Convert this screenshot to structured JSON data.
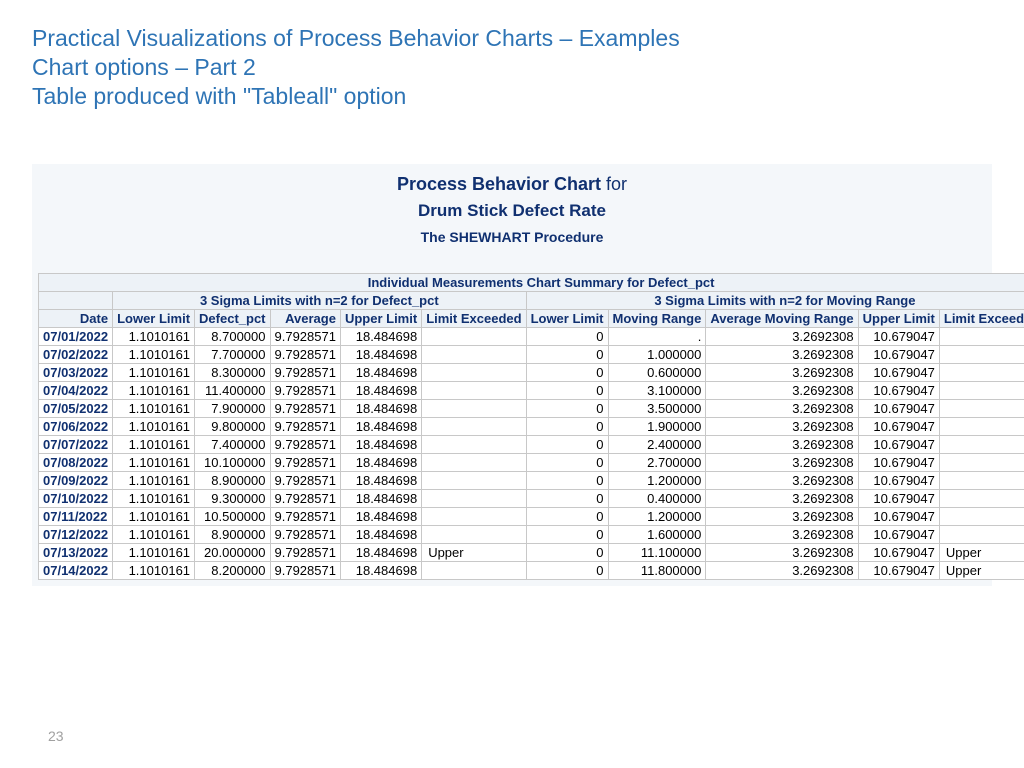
{
  "heading": {
    "line1": "Practical Visualizations of Process Behavior Charts – Examples",
    "line2": "Chart options – Part 2",
    "line3": "Table produced with \"Tableall\" option"
  },
  "report": {
    "title_prefix": "Process Behavior Chart",
    "title_for": "for",
    "title_subject": "Drum Stick Defect Rate",
    "procedure": "The SHEWHART Procedure",
    "summary_heading": "Individual Measurements Chart Summary for Defect_pct",
    "group1": "3 Sigma Limits with n=2 for Defect_pct",
    "group2": "3 Sigma Limits with n=2 for Moving Range",
    "cols": {
      "date": "Date",
      "lower_limit": "Lower Limit",
      "defect_pct": "Defect_pct",
      "average": "Average",
      "upper_limit": "Upper Limit",
      "limit_exceeded": "Limit Exceeded",
      "mr_lower_limit": "Lower Limit",
      "moving_range": "Moving Range",
      "avg_moving_range": "Average Moving Range",
      "mr_upper_limit": "Upper Limit",
      "mr_limit_exceeded": "Limit Exceeded"
    }
  },
  "chart_data": {
    "type": "table",
    "title": "Individual Measurements Chart Summary for Defect_pct",
    "rows": [
      {
        "date": "07/01/2022",
        "ll": "1.1010161",
        "defect": "8.700000",
        "avg": "9.7928571",
        "ul": "18.484698",
        "le": "",
        "mrll": "0",
        "mr": ".",
        "amr": "3.2692308",
        "mrul": "10.679047",
        "mrle": ""
      },
      {
        "date": "07/02/2022",
        "ll": "1.1010161",
        "defect": "7.700000",
        "avg": "9.7928571",
        "ul": "18.484698",
        "le": "",
        "mrll": "0",
        "mr": "1.000000",
        "amr": "3.2692308",
        "mrul": "10.679047",
        "mrle": ""
      },
      {
        "date": "07/03/2022",
        "ll": "1.1010161",
        "defect": "8.300000",
        "avg": "9.7928571",
        "ul": "18.484698",
        "le": "",
        "mrll": "0",
        "mr": "0.600000",
        "amr": "3.2692308",
        "mrul": "10.679047",
        "mrle": ""
      },
      {
        "date": "07/04/2022",
        "ll": "1.1010161",
        "defect": "11.400000",
        "avg": "9.7928571",
        "ul": "18.484698",
        "le": "",
        "mrll": "0",
        "mr": "3.100000",
        "amr": "3.2692308",
        "mrul": "10.679047",
        "mrle": ""
      },
      {
        "date": "07/05/2022",
        "ll": "1.1010161",
        "defect": "7.900000",
        "avg": "9.7928571",
        "ul": "18.484698",
        "le": "",
        "mrll": "0",
        "mr": "3.500000",
        "amr": "3.2692308",
        "mrul": "10.679047",
        "mrle": ""
      },
      {
        "date": "07/06/2022",
        "ll": "1.1010161",
        "defect": "9.800000",
        "avg": "9.7928571",
        "ul": "18.484698",
        "le": "",
        "mrll": "0",
        "mr": "1.900000",
        "amr": "3.2692308",
        "mrul": "10.679047",
        "mrle": ""
      },
      {
        "date": "07/07/2022",
        "ll": "1.1010161",
        "defect": "7.400000",
        "avg": "9.7928571",
        "ul": "18.484698",
        "le": "",
        "mrll": "0",
        "mr": "2.400000",
        "amr": "3.2692308",
        "mrul": "10.679047",
        "mrle": ""
      },
      {
        "date": "07/08/2022",
        "ll": "1.1010161",
        "defect": "10.100000",
        "avg": "9.7928571",
        "ul": "18.484698",
        "le": "",
        "mrll": "0",
        "mr": "2.700000",
        "amr": "3.2692308",
        "mrul": "10.679047",
        "mrle": ""
      },
      {
        "date": "07/09/2022",
        "ll": "1.1010161",
        "defect": "8.900000",
        "avg": "9.7928571",
        "ul": "18.484698",
        "le": "",
        "mrll": "0",
        "mr": "1.200000",
        "amr": "3.2692308",
        "mrul": "10.679047",
        "mrle": ""
      },
      {
        "date": "07/10/2022",
        "ll": "1.1010161",
        "defect": "9.300000",
        "avg": "9.7928571",
        "ul": "18.484698",
        "le": "",
        "mrll": "0",
        "mr": "0.400000",
        "amr": "3.2692308",
        "mrul": "10.679047",
        "mrle": ""
      },
      {
        "date": "07/11/2022",
        "ll": "1.1010161",
        "defect": "10.500000",
        "avg": "9.7928571",
        "ul": "18.484698",
        "le": "",
        "mrll": "0",
        "mr": "1.200000",
        "amr": "3.2692308",
        "mrul": "10.679047",
        "mrle": ""
      },
      {
        "date": "07/12/2022",
        "ll": "1.1010161",
        "defect": "8.900000",
        "avg": "9.7928571",
        "ul": "18.484698",
        "le": "",
        "mrll": "0",
        "mr": "1.600000",
        "amr": "3.2692308",
        "mrul": "10.679047",
        "mrle": ""
      },
      {
        "date": "07/13/2022",
        "ll": "1.1010161",
        "defect": "20.000000",
        "avg": "9.7928571",
        "ul": "18.484698",
        "le": "Upper",
        "mrll": "0",
        "mr": "11.100000",
        "amr": "3.2692308",
        "mrul": "10.679047",
        "mrle": "Upper"
      },
      {
        "date": "07/14/2022",
        "ll": "1.1010161",
        "defect": "8.200000",
        "avg": "9.7928571",
        "ul": "18.484698",
        "le": "",
        "mrll": "0",
        "mr": "11.800000",
        "amr": "3.2692308",
        "mrul": "10.679047",
        "mrle": "Upper"
      }
    ]
  },
  "page_number": "23"
}
